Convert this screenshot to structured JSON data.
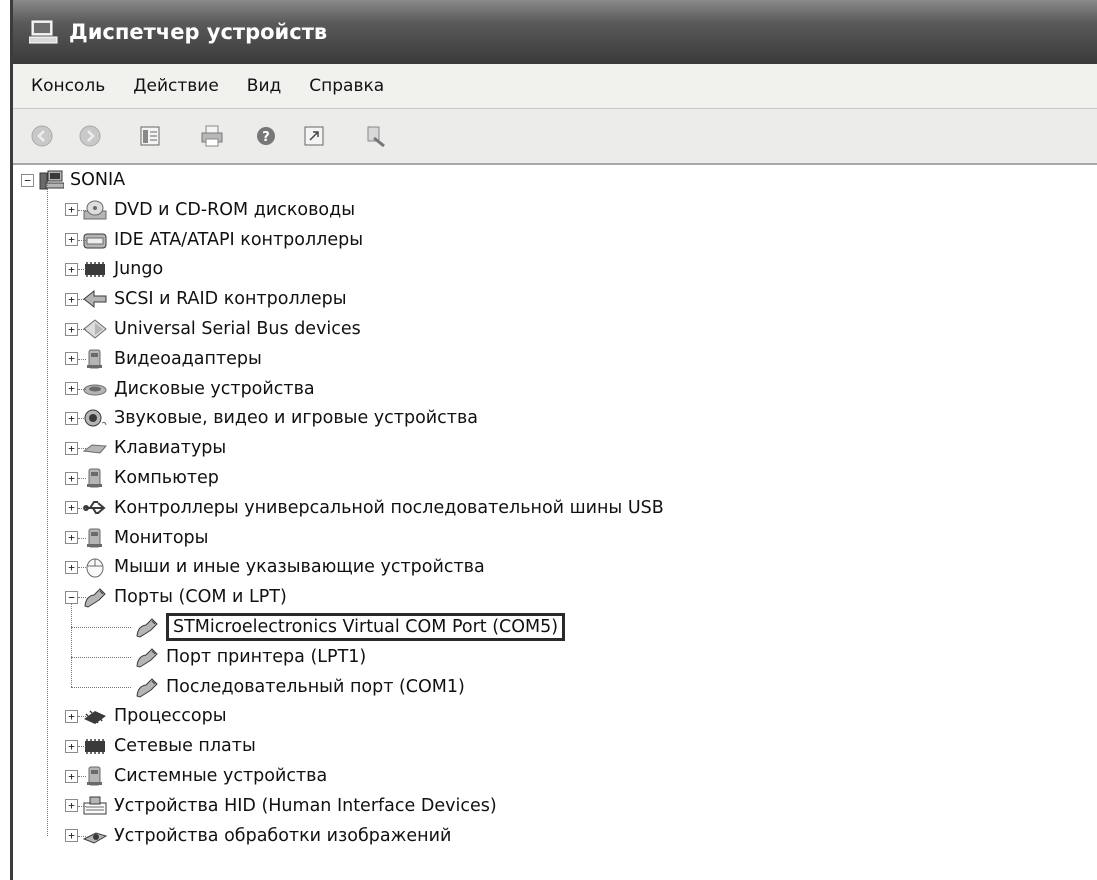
{
  "window": {
    "title": "Диспетчер устройств"
  },
  "menu": [
    "Консоль",
    "Действие",
    "Вид",
    "Справка"
  ],
  "toolbar": {
    "buttons": [
      "back-icon",
      "forward-icon",
      "properties-icon",
      "print-icon",
      "help-icon",
      "console-tree-icon",
      "scan-hardware-icon"
    ]
  },
  "tree": {
    "root": "SONIA",
    "categories": [
      {
        "label": "DVD и CD-ROM дисководы",
        "icon": "dvd-drive-icon",
        "expanded": false
      },
      {
        "label": "IDE ATA/ATAPI контроллеры",
        "icon": "ide-controller-icon",
        "expanded": false
      },
      {
        "label": "Jungo",
        "icon": "chip-icon",
        "expanded": false
      },
      {
        "label": "SCSI и RAID контроллеры",
        "icon": "scsi-icon",
        "expanded": false
      },
      {
        "label": "Universal Serial Bus devices",
        "icon": "usb-device-icon",
        "expanded": false
      },
      {
        "label": "Видеоадаптеры",
        "icon": "display-adapter-icon",
        "expanded": false
      },
      {
        "label": "Дисковые устройства",
        "icon": "disk-drive-icon",
        "expanded": false
      },
      {
        "label": "Звуковые, видео и игровые устройства",
        "icon": "sound-icon",
        "expanded": false
      },
      {
        "label": "Клавиатуры",
        "icon": "keyboard-icon",
        "expanded": false
      },
      {
        "label": "Компьютер",
        "icon": "computer-icon",
        "expanded": false
      },
      {
        "label": "Контроллеры универсальной последовательной шины USB",
        "icon": "usb-controller-icon",
        "expanded": false
      },
      {
        "label": "Мониторы",
        "icon": "monitor-icon",
        "expanded": false
      },
      {
        "label": "Мыши и иные указывающие устройства",
        "icon": "mouse-icon",
        "expanded": false
      },
      {
        "label": "Порты (COM и LPT)",
        "icon": "port-icon",
        "expanded": true,
        "children": [
          {
            "label": "STMicroelectronics Virtual COM Port (COM5)",
            "icon": "port-icon",
            "highlighted": true
          },
          {
            "label": "Порт принтера (LPT1)",
            "icon": "port-icon"
          },
          {
            "label": "Последовательный порт (COM1)",
            "icon": "port-icon"
          }
        ]
      },
      {
        "label": "Процессоры",
        "icon": "processor-icon",
        "expanded": false
      },
      {
        "label": "Сетевые платы",
        "icon": "network-card-icon",
        "expanded": false
      },
      {
        "label": "Системные устройства",
        "icon": "system-device-icon",
        "expanded": false
      },
      {
        "label": "Устройства HID (Human Interface Devices)",
        "icon": "hid-icon",
        "expanded": false
      },
      {
        "label": "Устройства обработки изображений",
        "icon": "imaging-device-icon",
        "expanded": false
      }
    ]
  }
}
